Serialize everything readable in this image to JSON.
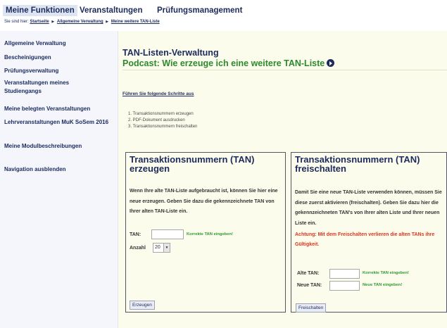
{
  "topnav": {
    "tabs": [
      "Meine Funktionen",
      "Veranstaltungen",
      "Prüfungsmanagement"
    ]
  },
  "breadcrumb": {
    "prefix": "Sie sind hier:",
    "items": [
      "Startseite",
      "Allgemeine Verwaltung",
      "Meine weitere TAN-Liste"
    ]
  },
  "sidebar": {
    "items": [
      "Allgemeine Verwaltung",
      "Bescheinigungen",
      "Prüfungsverwaltung",
      "Veranstaltungen meines Studiengangs",
      "Meine belegten Veranstaltungen",
      "Lehrveranstaltungen MuK SoSem 2016",
      "Meine Modulbeschreibungen",
      "Navigation ausblenden"
    ]
  },
  "main": {
    "title": "TAN-Listen-Verwaltung",
    "podcast_link": "Podcast: Wie erzeuge ich eine weitere TAN-Liste",
    "steps_heading": "Führen Sie folgende Schritte aus",
    "steps": [
      "1. Transaktionsnummern erzeugen",
      "2. PDF-Dokument ausdrucken",
      "3. Transaktionsnummern freischalten"
    ]
  },
  "generate_panel": {
    "title": "Transaktionsnummern (TAN) erzeugen",
    "description": "Wenn Ihre alte TAN-Liste aufgebraucht ist, können Sie hier eine neue erzeugen. Geben Sie dazu die gekennzeichnete TAN von Ihrer alten TAN-Liste ein.",
    "tan_label": "TAN:",
    "tan_hint": "Korrekte TAN eingeben!",
    "count_label": "Anzahl",
    "count_value": "20",
    "button": "Erzeugen"
  },
  "unlock_panel": {
    "title": "Transaktionsnummern (TAN) freischalten",
    "description": "Damit Sie eine neue TAN-Liste verwenden können, müssen Sie diese zuerst aktivieren (freischalten). Geben Sie dazu hier die gekennzeichneten TAN's von Ihrer alten Liste und Ihrer neuen Liste ein.",
    "warning": "Achtung: Mit dem Freischalten verlieren die alten TANs ihre Gültigkeit.",
    "old_tan_label": "Alte TAN:",
    "old_tan_hint": "Korrekte TAN eingeben!",
    "new_tan_label": "Neue TAN:",
    "new_tan_hint": "Neue TAN eingeben!",
    "button": "Freischalten"
  },
  "colors": {
    "nav_text": "#1c2a5c",
    "podcast_green": "#2c8a2c",
    "hint_green": "#2c9a2c",
    "warning_red": "#e2331c",
    "content_bg": "#fcfced",
    "sidebar_bg": "#f4f6fc"
  }
}
